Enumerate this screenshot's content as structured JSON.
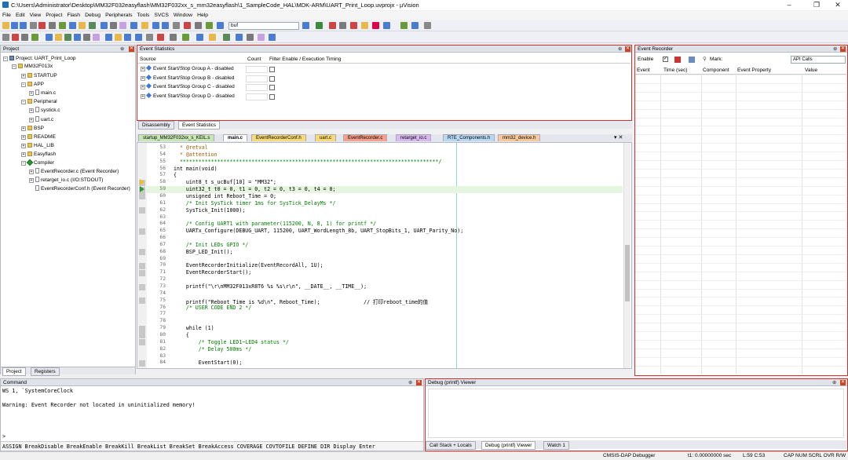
{
  "title": "C:\\Users\\Administrator\\Desktop\\MM32F032easyflash\\MM32F032xx_s_mm32easyflash\\1_SampleCode_HAL\\MDK-ARM\\UART_Print_Loop.uvprojx - µVision",
  "menus": [
    "File",
    "Edit",
    "View",
    "Project",
    "Flash",
    "Debug",
    "Peripherals",
    "Tools",
    "SVCS",
    "Window",
    "Help"
  ],
  "toolbar": {
    "find_value": "buf"
  },
  "project": {
    "header": "Project",
    "root": "Project: UART_Print_Loop",
    "target": "MM32F013x",
    "items": [
      {
        "t": "STARTUP",
        "l": 3,
        "k": "folder"
      },
      {
        "t": "APP",
        "l": 3,
        "k": "folder"
      },
      {
        "t": "main.c",
        "l": 4,
        "k": "file"
      },
      {
        "t": "Peripheral",
        "l": 3,
        "k": "folder"
      },
      {
        "t": "systick.c",
        "l": 4,
        "k": "file"
      },
      {
        "t": "uart.c",
        "l": 4,
        "k": "file"
      },
      {
        "t": "BSP",
        "l": 3,
        "k": "folder"
      },
      {
        "t": "README",
        "l": 3,
        "k": "folder"
      },
      {
        "t": "HAL_LIB",
        "l": 3,
        "k": "folder"
      },
      {
        "t": "Easyflash",
        "l": 3,
        "k": "folder"
      },
      {
        "t": "Compiler",
        "l": 3,
        "k": "gem"
      },
      {
        "t": "EventRecorder.c (Event Recorder)",
        "l": 4,
        "k": "file"
      },
      {
        "t": "retarget_io.c (I/O:STDOUT)",
        "l": 4,
        "k": "file"
      },
      {
        "t": "EventRecorderConf.h (Event Recorder)",
        "l": 4,
        "k": "file"
      }
    ],
    "tabs": [
      "Project",
      "Registers"
    ]
  },
  "event_stats": {
    "header": "Event Statistics",
    "cols": [
      "Source",
      "Count",
      "Filter Enable / Execution Timing"
    ],
    "rows": [
      "Event Start/Stop Group A - disabled",
      "Event Start/Stop Group B - disabled",
      "Event Start/Stop Group C - disabled",
      "Event Start/Stop Group D - disabled"
    ],
    "tabs": [
      "Disassembly",
      "Event Statistics"
    ]
  },
  "file_tabs": [
    {
      "name": "startup_MM32F032xx_s_KEIL.s",
      "color": "#c8e6b4"
    },
    {
      "name": "main.c",
      "color": "#ffffff"
    },
    {
      "name": "EventRecorderConf.h",
      "color": "#f7d97a"
    },
    {
      "name": "uart.c",
      "color": "#f7d97a"
    },
    {
      "name": "EventRecorder.c",
      "color": "#f4a08a"
    },
    {
      "name": "retarget_io.c",
      "color": "#d9b8f0"
    },
    {
      "name": "RTE_Components.h",
      "color": "#b8d8f4"
    },
    {
      "name": "mm32_device.h",
      "color": "#f8c89a"
    }
  ],
  "code": [
    {
      "n": "53",
      "t": "  * @retval",
      "c": "#a25c00"
    },
    {
      "n": "54",
      "t": "  * @attention",
      "c": "#a25c00"
    },
    {
      "n": "55",
      "t": "  ***********************************************************************************/",
      "c": "#008000"
    },
    {
      "n": "56",
      "t": "int main(void)",
      "c": "#000"
    },
    {
      "n": "57",
      "t": "{",
      "c": "#000"
    },
    {
      "n": "58",
      "t": "    uint8_t s_ucBuf[10] = \"MM32\";",
      "c": "#000"
    },
    {
      "n": "59",
      "t": "    uint32_t t0 = 0, t1 = 0, t2 = 0, t3 = 0, t4 = 0;",
      "c": "#000"
    },
    {
      "n": "60",
      "t": "    unsigned int Reboot_Time = 0;",
      "c": "#000"
    },
    {
      "n": "61",
      "t": "    /* Init SysTick timer 1ms for SysTick_DelayMs */",
      "c": "#008000"
    },
    {
      "n": "62",
      "t": "    SysTick_Init(1000);",
      "c": "#000"
    },
    {
      "n": "63",
      "t": "",
      "c": "#000"
    },
    {
      "n": "64",
      "t": "    /* Config UART1 with parameter(115200, N, 8, 1) for printf */",
      "c": "#008000"
    },
    {
      "n": "65",
      "t": "    UARTx_Configure(DEBUG_UART, 115200, UART_WordLength_8b, UART_StopBits_1, UART_Parity_No);",
      "c": "#000"
    },
    {
      "n": "66",
      "t": "",
      "c": "#000"
    },
    {
      "n": "67",
      "t": "    /* Init LEDs GPIO */",
      "c": "#008000"
    },
    {
      "n": "68",
      "t": "    BSP_LED_Init();",
      "c": "#000"
    },
    {
      "n": "69",
      "t": "",
      "c": "#000"
    },
    {
      "n": "70",
      "t": "    EventRecorderInitialize(EventRecordAll, 1U);",
      "c": "#000"
    },
    {
      "n": "71",
      "t": "    EventRecorderStart();",
      "c": "#000"
    },
    {
      "n": "72",
      "t": "",
      "c": "#000"
    },
    {
      "n": "73",
      "t": "    printf(\"\\r\\nMM32F013xR8T6 %s %s\\r\\n\", __DATE__, __TIME__);",
      "c": "#000"
    },
    {
      "n": "74",
      "t": "",
      "c": "#000"
    },
    {
      "n": "75",
      "t": "    printf(\"Reboot_Time is %d\\n\", Reboot_Time);              // 打印reboot_time的值",
      "c": "#000"
    },
    {
      "n": "76",
      "t": "    /* USER CODE END 2 */",
      "c": "#008000"
    },
    {
      "n": "77",
      "t": "",
      "c": "#000"
    },
    {
      "n": "78",
      "t": "",
      "c": "#000"
    },
    {
      "n": "79",
      "t": "    while (1)",
      "c": "#000"
    },
    {
      "n": "80",
      "t": "    {",
      "c": "#000"
    },
    {
      "n": "81",
      "t": "        /* Toggle LED1~LED4 status */",
      "c": "#008000"
    },
    {
      "n": "82",
      "t": "        /* Delay 500ms */",
      "c": "#008000"
    },
    {
      "n": "83",
      "t": "",
      "c": "#000"
    },
    {
      "n": "84",
      "t": "        EventStart(0);",
      "c": "#000"
    }
  ],
  "event_recorder": {
    "header": "Event Recorder",
    "enable": "Enable",
    "mark": "Mark:",
    "filter": "API Calls",
    "cols": [
      "Event",
      "Time (sec)",
      "Component",
      "Event Property",
      "Value"
    ]
  },
  "command": {
    "header": "Command",
    "lines": [
      "WS 1, `SystemCoreClock",
      "",
      "Warning: Event Recorder not located in uninitialized memory!"
    ],
    "prompt": ">",
    "hint": "ASSIGN BreakDisable BreakEnable BreakKill BreakList BreakSet BreakAccess COVERAGE COVTOFILE DEFINE DIR Display Enter"
  },
  "debug_viewer": {
    "header": "Debug (printf) Viewer",
    "tabs": [
      "Call Stack + Locals",
      "Debug (printf) Viewer",
      "Watch 1"
    ]
  },
  "status": {
    "debugger": "CMSIS-DAP Debugger",
    "time": "t1: 0.00000000 sec",
    "pos": "L:59 C:53",
    "keys": "CAP  NUM  SCRL  OVR  R/W"
  }
}
